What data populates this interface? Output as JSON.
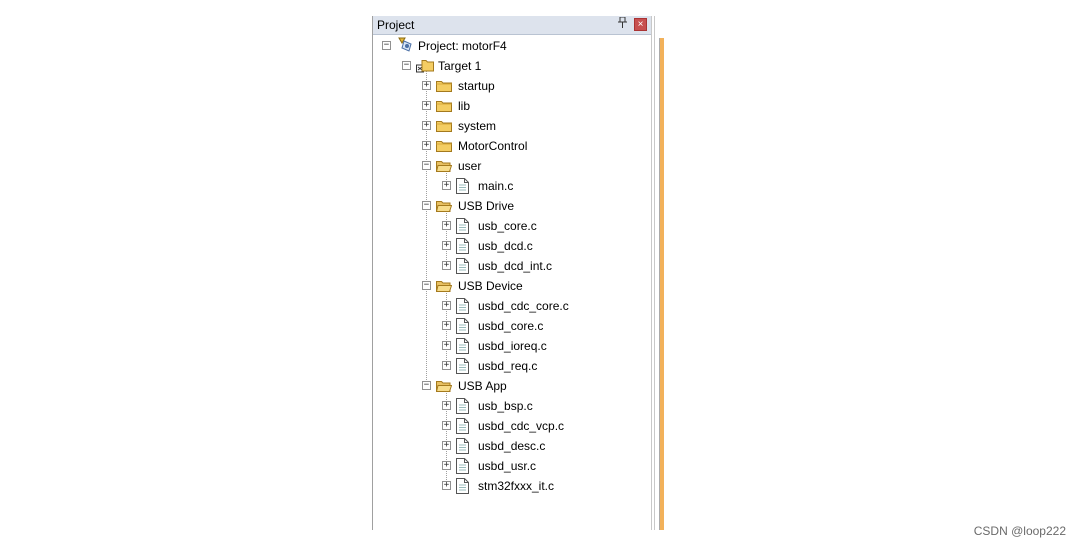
{
  "panel": {
    "title": "Project",
    "pin": "📌",
    "close": "×"
  },
  "tree": [
    {
      "type": "project",
      "label": "Project: motorF4",
      "exp": "−"
    },
    {
      "type": "folder-open",
      "label": "Target 1",
      "exp": "−"
    },
    {
      "type": "folder",
      "label": "startup",
      "exp": "+"
    },
    {
      "type": "folder",
      "label": "lib",
      "exp": "+"
    },
    {
      "type": "folder",
      "label": "system",
      "exp": "+"
    },
    {
      "type": "folder",
      "label": "MotorControl",
      "exp": "+"
    },
    {
      "type": "folder-open",
      "label": "user",
      "exp": "−"
    },
    {
      "type": "file",
      "label": "main.c",
      "exp": "+"
    },
    {
      "type": "folder-open",
      "label": "USB Drive",
      "exp": "−"
    },
    {
      "type": "file",
      "label": "usb_core.c",
      "exp": "+"
    },
    {
      "type": "file",
      "label": "usb_dcd.c",
      "exp": "+"
    },
    {
      "type": "file",
      "label": "usb_dcd_int.c",
      "exp": "+"
    },
    {
      "type": "folder-open",
      "label": "USB Device",
      "exp": "−"
    },
    {
      "type": "file",
      "label": "usbd_cdc_core.c",
      "exp": "+"
    },
    {
      "type": "file",
      "label": "usbd_core.c",
      "exp": "+"
    },
    {
      "type": "file",
      "label": "usbd_ioreq.c",
      "exp": "+"
    },
    {
      "type": "file",
      "label": "usbd_req.c",
      "exp": "+"
    },
    {
      "type": "folder-open",
      "label": "USB App",
      "exp": "−"
    },
    {
      "type": "file",
      "label": "usb_bsp.c",
      "exp": "+"
    },
    {
      "type": "file",
      "label": "usbd_cdc_vcp.c",
      "exp": "+"
    },
    {
      "type": "file",
      "label": "usbd_desc.c",
      "exp": "+"
    },
    {
      "type": "file",
      "label": "usbd_usr.c",
      "exp": "+"
    },
    {
      "type": "file",
      "label": "stm32fxxx_it.c",
      "exp": "+"
    }
  ],
  "watermark": "CSDN @loop222"
}
